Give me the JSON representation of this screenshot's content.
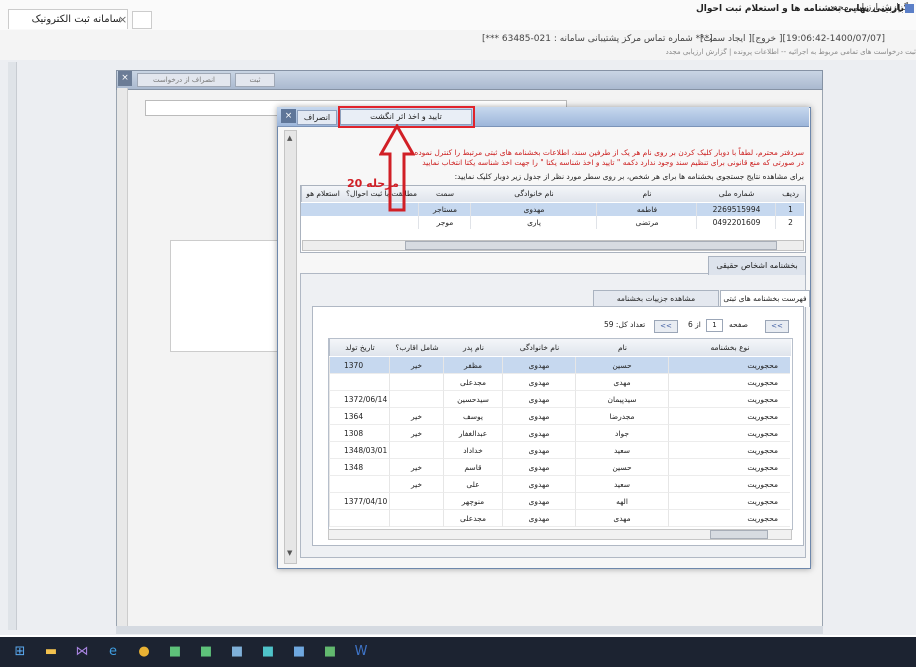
{
  "browser": {
    "tab_title": "سامانه ثبت الکترونیک اسناد",
    "tab_close": "×"
  },
  "header": {
    "session": "[ایجاد سمت ][خروج ][1400/07/07-19:06:42]",
    "support": "[*** شماره تماس مرکز پشتیبانی سامانه : 021-63485 ***]",
    "nav_links": "ثبت درخواست های تمامی مربوط به اجرائیه -- اطلاعات پرونده | گزارش ارزیابی مجدد"
  },
  "app": {
    "title": "گزارش ارزیابی مجدد",
    "btn_register": "ثبت",
    "btn_cancel_request": "انصراف از درخواست",
    "close": "×"
  },
  "dialog": {
    "title": "بازبینی نهایی بخشنامه ها و استعلام ثبت احوال",
    "confirm_button": "تایید و اخذ اثر انگشت",
    "cancel_button": "انصراف",
    "close": "×",
    "notice_line1": "سردفتر محترم، لطفاً با دوبار کلیک کردن بر روی نام هر یک از طرفین سند، اطلاعات بخشنامه های ثبتی مرتبط را کنترل نموده",
    "notice_line2": "در صورتی که منع قانونی برای تنظیم سند وجود ندارد دکمه \" تایید و اخذ شناسه یکتا \" را جهت اخذ شناسه یکتا انتخاب نمایید",
    "instruction": "برای مشاهده نتایج جستجوی بخشنامه ها برای هر شخص، بر روی سطر مورد نظر از جدول زیر دوبار کلیک نمایید:"
  },
  "persons_grid": {
    "columns": [
      "ردیف",
      "شماره ملی",
      "نام",
      "نام خانوادگی",
      "سمت",
      "مطابقت با ثبت احوال؟",
      "استعلام هو"
    ],
    "rows": [
      [
        "1",
        "2269515994",
        "فاطمه",
        "مهدوی",
        "مستاجر",
        "",
        ""
      ],
      [
        "2",
        "0492201609",
        "مرتضی",
        "یاری",
        "موجر",
        "",
        ""
      ]
    ]
  },
  "panel": {
    "outer_tab": "بخشنامه اشخاص حقیقی",
    "tab_list": "فهرست بخشنامه های ثبتی",
    "tab_details": "مشاهده جزییات بخشنامه"
  },
  "pager": {
    "page_label": "صفحه",
    "page_value": "1",
    "of_label": "از 6",
    "total_label": "تعداد کل: 59",
    "first": "<<",
    "prev": "<<",
    "next": ">>",
    "last": ">>"
  },
  "circulars_grid": {
    "columns": [
      "نوع بخشنامه",
      "نام",
      "نام خانوادگی",
      "نام پدر",
      "شامل اقارب؟",
      "تاریخ تولد"
    ],
    "rows": [
      [
        "محجوریت",
        "حسین",
        "مهدوی",
        "مظفر",
        "خیر",
        "1370"
      ],
      [
        "محجوریت",
        "مهدی",
        "مهدوی",
        "مجدعلی",
        "",
        ""
      ],
      [
        "محجوریت",
        "سیدپیمان",
        "مهدوی",
        "سیدحسین",
        "",
        "1372/06/14"
      ],
      [
        "محجوریت",
        "مجدرضا",
        "مهدوی",
        "یوسف",
        "خیر",
        "1364"
      ],
      [
        "محجوریت",
        "جواد",
        "مهدوی",
        "عبدالغفار",
        "خیر",
        "1308"
      ],
      [
        "محجوریت",
        "سعید",
        "مهدوی",
        "خداداد",
        "",
        "1348/03/01"
      ],
      [
        "محجوریت",
        "حسین",
        "مهدوی",
        "قاسم",
        "خیر",
        "1348"
      ],
      [
        "محجوریت",
        "سعید",
        "مهدوی",
        "علی",
        "خیر",
        ""
      ],
      [
        "محجوریت",
        "الهه",
        "مهدوی",
        "منوچهر",
        "",
        "1377/04/10"
      ],
      [
        "محجوریت",
        "مهدی",
        "مهدوی",
        "مجدعلی",
        "",
        ""
      ]
    ]
  },
  "annotation": {
    "step": "مرحله 20",
    "color": "#d11f26"
  },
  "taskbar": {
    "icons": [
      "windows-icon",
      "file-explorer-icon",
      "visual-studio-icon",
      "internet-explorer-icon",
      "chrome-icon",
      "app-icon",
      "app-icon",
      "app-icon",
      "app-icon",
      "app-icon",
      "app-icon",
      "word-icon"
    ]
  }
}
